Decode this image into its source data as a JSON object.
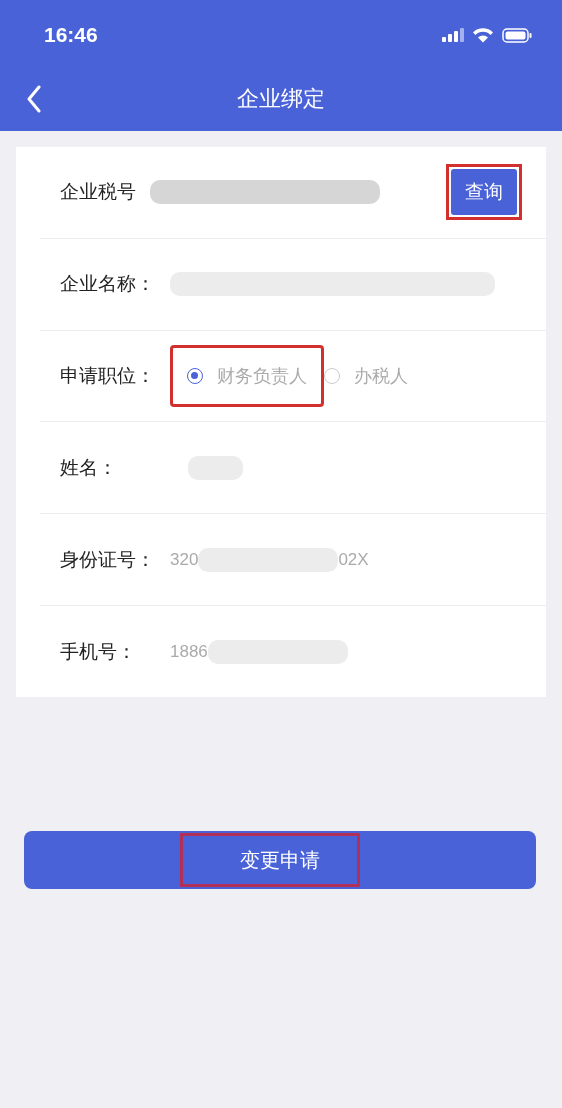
{
  "status_bar": {
    "time": "16:46"
  },
  "nav_bar": {
    "title": "企业绑定"
  },
  "fields": [
    {
      "kind": "query",
      "label": "企业税号",
      "redacted": true,
      "button": {
        "label": "查询",
        "highlighted": true
      }
    },
    {
      "kind": "text",
      "label": "企业名称：",
      "redacted": true
    },
    {
      "kind": "radio",
      "label": "申请职位：",
      "options": [
        {
          "label": "财务负责人",
          "selected": true,
          "highlighted": true
        },
        {
          "label": "办税人",
          "selected": false,
          "highlighted": false
        }
      ]
    },
    {
      "kind": "text",
      "label": "姓名：",
      "redacted": true
    },
    {
      "kind": "text",
      "label": "身份证号：",
      "value_start": "320",
      "redacted": true,
      "value_end": "02X"
    },
    {
      "kind": "text",
      "label": "手机号：",
      "value_start": "1886",
      "redacted": true
    }
  ],
  "submit": {
    "label": "变更申请",
    "highlighted": true
  }
}
